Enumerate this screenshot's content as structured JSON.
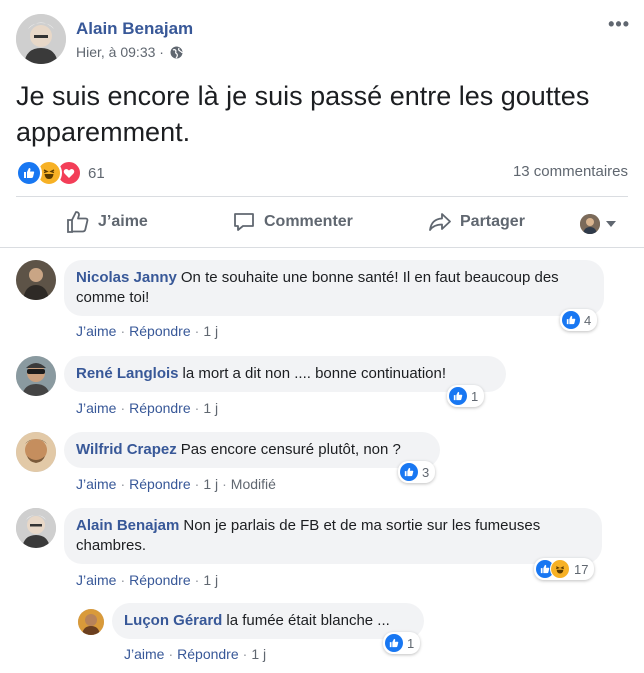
{
  "post": {
    "author": "Alain Benajam",
    "time": "Hier, à 09:33 ·",
    "text": "Je suis encore là je suis passé entre les gouttes apparemment.",
    "reactions": [
      "like-icon",
      "haha-icon",
      "love-icon"
    ],
    "reaction_count": "61",
    "comments_count": "13 commentaires"
  },
  "actions": {
    "like": "J’aime",
    "comment": "Commenter",
    "share": "Partager"
  },
  "comments": [
    {
      "name": "Nicolas Janny",
      "text": "On te souhaite une bonne santé! Il en faut beaucoup des comme toi!",
      "like": "J’aime",
      "reply": "Répondre",
      "time": "1 j",
      "reaction_count": "4"
    },
    {
      "name": "René Langlois",
      "text": "la mort a dit non .... bonne continuation!",
      "like": "J’aime",
      "reply": "Répondre",
      "time": "1 j",
      "reaction_count": "1"
    },
    {
      "name": "Wilfrid Crapez",
      "text": "Pas encore censuré plutôt, non ?",
      "like": "J’aime",
      "reply": "Répondre",
      "time": "1 j",
      "edited": "Modifié",
      "reaction_count": "3"
    },
    {
      "name": "Alain Benajam",
      "text": "Non je parlais de FB et de ma sortie sur les fumeuses chambres.",
      "like": "J’aime",
      "reply": "Répondre",
      "time": "1 j",
      "reaction_count": "17"
    },
    {
      "name": "Luçon Gérard",
      "text": "la fumée était blanche ...",
      "like": "J’aime",
      "reply": "Répondre",
      "time": "1 j",
      "reaction_count": "1"
    }
  ],
  "colors": {
    "link": "#385898",
    "like_blue": "#1877f2",
    "haha_yellow": "#f7b125",
    "love_red": "#f33e58",
    "bubble": "#f2f3f5"
  }
}
